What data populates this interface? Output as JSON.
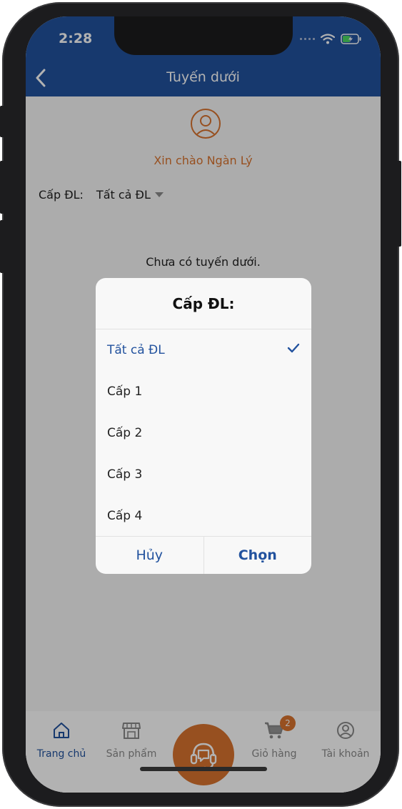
{
  "status": {
    "time": "2:28"
  },
  "header": {
    "title": "Tuyến dưới"
  },
  "profile": {
    "greeting": "Xin chào Ngàn Lý"
  },
  "filter": {
    "label": "Cấp ĐL:",
    "value": "Tất cả ĐL"
  },
  "list": {
    "empty_message": "Chưa có tuyến dưới."
  },
  "picker": {
    "title": "Cấp ĐL:",
    "options": [
      "Tất cả ĐL",
      "Cấp 1",
      "Cấp 2",
      "Cấp 3",
      "Cấp 4"
    ],
    "selected_index": 0,
    "cancel_label": "Hủy",
    "confirm_label": "Chọn"
  },
  "tabs": {
    "home": "Trang chủ",
    "products": "Sản phẩm",
    "cart": "Giỏ hàng",
    "cart_badge": "2",
    "account": "Tài khoản"
  },
  "colors": {
    "primary": "#22529e",
    "accent": "#d9732e"
  },
  "icons": [
    "back-chevron-icon",
    "user-icon",
    "caret-down-icon",
    "check-icon",
    "home-icon",
    "store-icon",
    "headset-icon",
    "cart-icon",
    "account-icon",
    "wifi-icon",
    "battery-icon"
  ]
}
